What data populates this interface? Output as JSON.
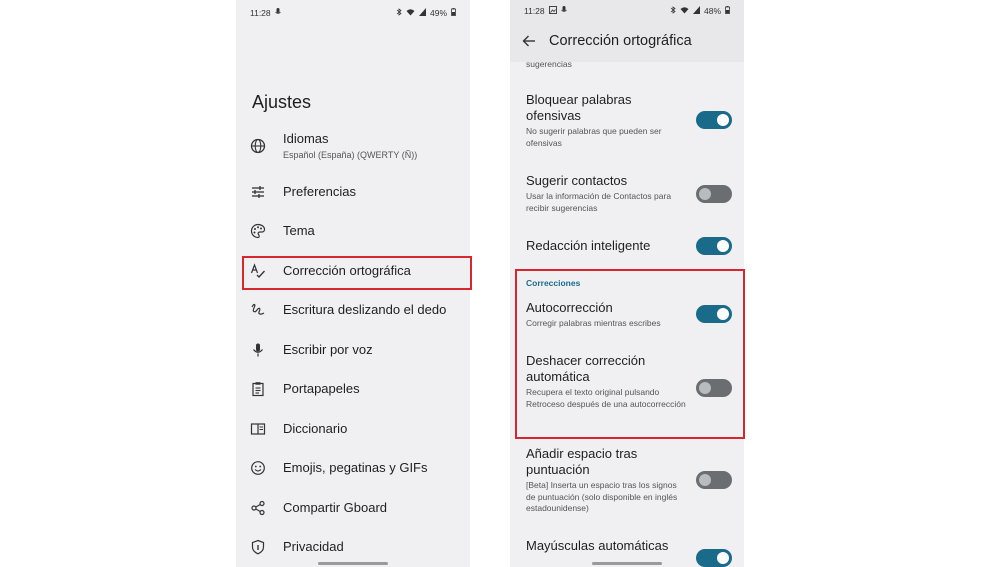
{
  "left": {
    "status": {
      "time": "11:28",
      "battery": "49%"
    },
    "title": "Ajustes",
    "items": [
      {
        "label": "Idiomas",
        "sub": "Español (España) (QWERTY (Ñ))",
        "icon": "globe-icon"
      },
      {
        "label": "Preferencias",
        "icon": "sliders-icon"
      },
      {
        "label": "Tema",
        "icon": "palette-icon"
      },
      {
        "label": "Corrección ortográfica",
        "icon": "spellcheck-icon"
      },
      {
        "label": "Escritura deslizando el dedo",
        "icon": "gesture-icon"
      },
      {
        "label": "Escribir por voz",
        "icon": "mic-icon"
      },
      {
        "label": "Portapapeles",
        "icon": "clipboard-icon"
      },
      {
        "label": "Diccionario",
        "icon": "book-icon"
      },
      {
        "label": "Emojis, pegatinas y GIFs",
        "icon": "smiley-icon"
      },
      {
        "label": "Compartir Gboard",
        "icon": "share-icon"
      },
      {
        "label": "Privacidad",
        "icon": "shield-icon"
      }
    ]
  },
  "right": {
    "status": {
      "time": "11:28",
      "battery": "48%"
    },
    "title": "Corrección ortográfica",
    "clipped_text": "sugerencias",
    "section": "Correcciones",
    "items": [
      {
        "title": "Bloquear palabras ofensivas",
        "desc": "No sugerir palabras que pueden ser ofensivas",
        "on": true
      },
      {
        "title": "Sugerir contactos",
        "desc": "Usar la información de Contactos para recibir sugerencias",
        "on": false
      },
      {
        "title": "Redacción inteligente",
        "desc": "",
        "on": true
      },
      {
        "title": "Autocorrección",
        "desc": "Corregir palabras mientras escribes",
        "on": true
      },
      {
        "title": "Deshacer corrección automática",
        "desc": "Recupera el texto original pulsando Retroceso después de una autocorrección",
        "on": false
      },
      {
        "title": "Añadir espacio tras puntuación",
        "desc": "[Beta] Inserta un espacio tras los signos de puntuación (solo disponible en inglés estadounidense)",
        "on": false
      },
      {
        "title": "Mayúsculas automáticas",
        "desc": "",
        "on": true
      }
    ]
  },
  "colors": {
    "accent": "#1a6a8a",
    "highlight": "#d6262e",
    "background": "#f0f0f2"
  }
}
